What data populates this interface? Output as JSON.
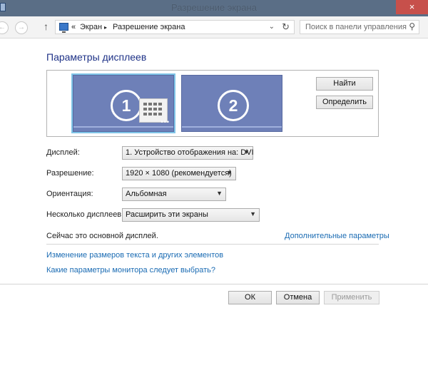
{
  "window": {
    "title": "Разрешение экрана",
    "close_glyph": "×"
  },
  "nav": {
    "back_icon": "back-arrow-icon",
    "forward_icon": "forward-arrow-icon",
    "up_icon": "up-arrow-icon",
    "breadcrumb_prefix": "«",
    "breadcrumb": [
      "Экран",
      "Разрешение экрана"
    ],
    "breadcrumb_sep": "▸",
    "search_placeholder": "Поиск в панели управления"
  },
  "main": {
    "heading": "Параметры дисплеев",
    "monitors": [
      {
        "number": "1",
        "selected": true
      },
      {
        "number": "2",
        "selected": false
      }
    ],
    "find_button": "Найти",
    "identify_button": "Определить",
    "fields": {
      "display": {
        "label": "Дисплей:",
        "value": "1. Устройство отображения на: DVI"
      },
      "resolution": {
        "label": "Разрешение:",
        "value": "1920 × 1080 (рекомендуется)"
      },
      "orientation": {
        "label": "Ориентация:",
        "value": "Альбомная"
      },
      "multiple": {
        "label": "Несколько дисплеев:",
        "value": "Расширить эти экраны"
      }
    },
    "status_text": "Сейчас это основной дисплей.",
    "advanced_link": "Дополнительные параметры",
    "links": [
      "Изменение размеров текста и других элементов",
      "Какие параметры монитора следует выбрать?"
    ]
  },
  "footer": {
    "ok": "ОК",
    "cancel": "Отмена",
    "apply": "Применить"
  },
  "colors": {
    "monitor": "#6e80b8",
    "selected_border": "#7fc5e8",
    "link": "#1a6bb3",
    "heading": "#1e3287"
  }
}
